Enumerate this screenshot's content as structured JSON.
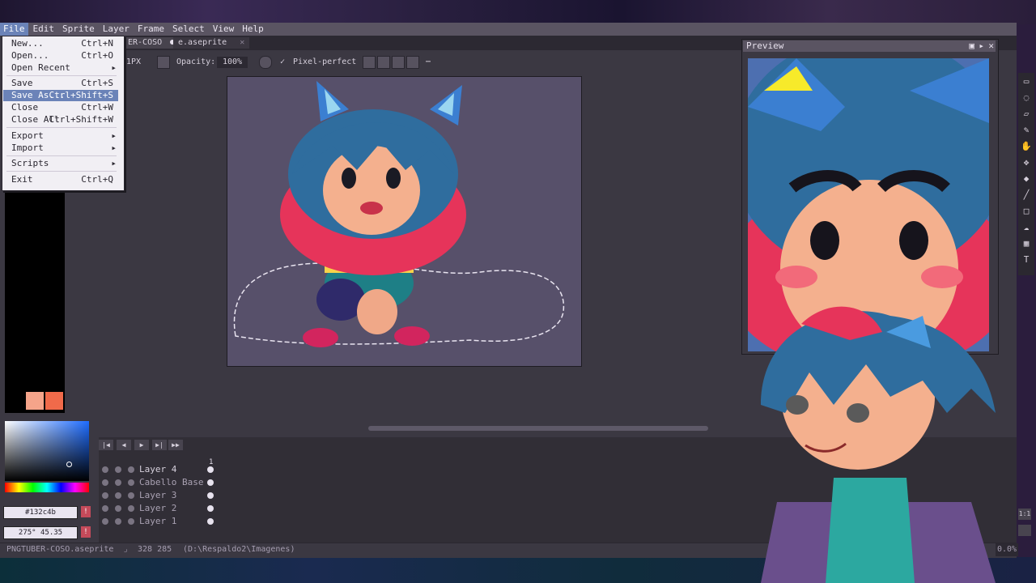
{
  "menu": {
    "items": [
      "File",
      "Edit",
      "Sprite",
      "Layer",
      "Frame",
      "Select",
      "View",
      "Help"
    ]
  },
  "tabs": [
    {
      "label": "ER-COSO"
    },
    {
      "label": "e.aseprite"
    }
  ],
  "toolbar": {
    "size_fragment": "1PX",
    "opacity_label": "Opacity:",
    "opacity_value": "100%",
    "pixel_perfect_label": "Pixel-perfect"
  },
  "file_menu": [
    {
      "label": "New...",
      "shortcut": "Ctrl+N"
    },
    {
      "label": "Open...",
      "shortcut": "Ctrl+O"
    },
    {
      "label": "Open Recent",
      "submenu": true
    },
    {
      "label": "Save",
      "shortcut": "Ctrl+S"
    },
    {
      "label": "Save As...",
      "shortcut": "Ctrl+Shift+S",
      "selected": true
    },
    {
      "label": "Close",
      "shortcut": "Ctrl+W"
    },
    {
      "label": "Close All",
      "shortcut": "Ctrl+Shift+W"
    },
    {
      "label": "Export",
      "submenu": true
    },
    {
      "label": "Import",
      "submenu": true
    },
    {
      "label": "Scripts",
      "submenu": true
    },
    {
      "label": "Exit",
      "shortcut": "Ctrl+Q"
    }
  ],
  "preview": {
    "title": "Preview"
  },
  "color": {
    "hex": "#132c4b",
    "hsv": "275° 45.35",
    "swatch1": "#f5a48a",
    "swatch2": "#f06a4a"
  },
  "timeline": {
    "frame_number": "1"
  },
  "layers": [
    "Layer 4",
    "Cabello Base",
    "Layer 3",
    "Layer 2",
    "Layer 1"
  ],
  "status": {
    "filename": "PNGTUBER-COSO.aseprite",
    "coords": "328 285",
    "path": "(D:\\Respaldo2\\Imagenes)",
    "zoom": "0.0%"
  },
  "zoom_buttons": [
    "1:1"
  ]
}
